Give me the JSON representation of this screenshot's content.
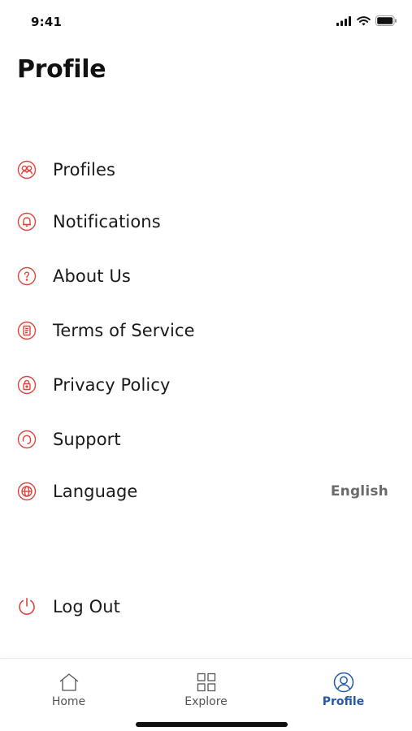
{
  "status_bar": {
    "time": "9:41"
  },
  "header": {
    "title": "Profile"
  },
  "menu": {
    "items": [
      {
        "label": "Profiles",
        "icon": "profiles-icon"
      },
      {
        "label": "Notifications",
        "icon": "bell-icon"
      },
      {
        "label": "About Us",
        "icon": "question-icon"
      },
      {
        "label": "Terms of Service",
        "icon": "document-icon"
      },
      {
        "label": "Privacy Policy",
        "icon": "lock-icon"
      },
      {
        "label": "Support",
        "icon": "headset-icon"
      },
      {
        "label": "Language",
        "icon": "globe-icon",
        "value": "English"
      }
    ],
    "logout": {
      "label": "Log Out",
      "icon": "power-icon"
    }
  },
  "tab_bar": {
    "tabs": [
      {
        "label": "Home",
        "icon": "home-icon",
        "active": false
      },
      {
        "label": "Explore",
        "icon": "grid-icon",
        "active": false
      },
      {
        "label": "Profile",
        "icon": "user-icon",
        "active": true
      }
    ]
  },
  "colors": {
    "accent_icon": "#e0443c",
    "active_tab": "#2458a8",
    "text": "#111111",
    "secondary_text": "#6b6b6b"
  }
}
